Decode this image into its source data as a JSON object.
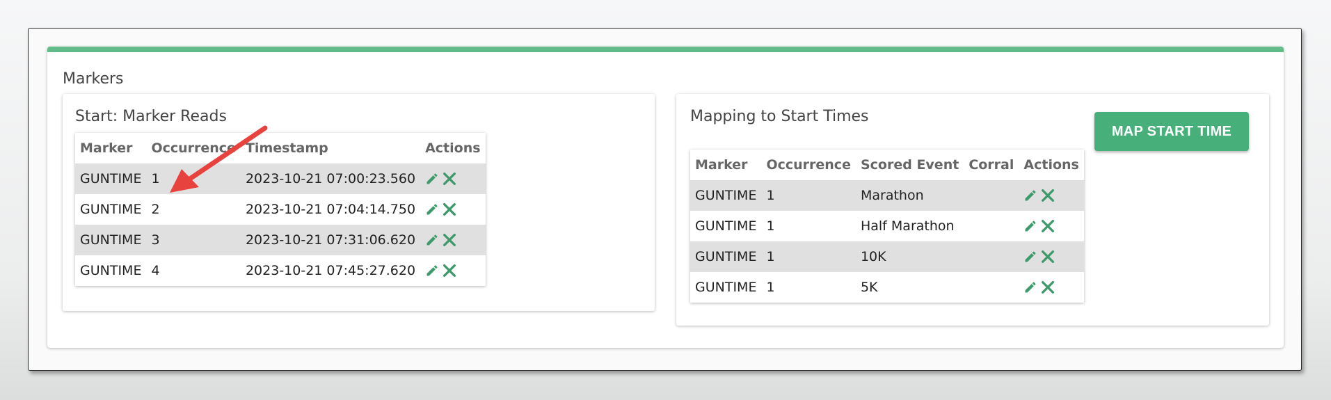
{
  "section": {
    "title": "Markers"
  },
  "reads": {
    "title": "Start: Marker Reads",
    "headers": {
      "marker": "Marker",
      "occurrence": "Occurrence",
      "timestamp": "Timestamp",
      "actions": "Actions"
    },
    "rows": [
      {
        "marker": "GUNTIME",
        "occurrence": "1",
        "timestamp": "2023-10-21 07:00:23.560"
      },
      {
        "marker": "GUNTIME",
        "occurrence": "2",
        "timestamp": "2023-10-21 07:04:14.750"
      },
      {
        "marker": "GUNTIME",
        "occurrence": "3",
        "timestamp": "2023-10-21 07:31:06.620"
      },
      {
        "marker": "GUNTIME",
        "occurrence": "4",
        "timestamp": "2023-10-21 07:45:27.620"
      }
    ]
  },
  "mapping": {
    "title": "Mapping to Start Times",
    "button_label": "MAP START TIME",
    "headers": {
      "marker": "Marker",
      "occurrence": "Occurrence",
      "event": "Scored Event",
      "corral": "Corral",
      "actions": "Actions"
    },
    "rows": [
      {
        "marker": "GUNTIME",
        "occurrence": "1",
        "event": "Marathon",
        "corral": ""
      },
      {
        "marker": "GUNTIME",
        "occurrence": "1",
        "event": "Half Marathon",
        "corral": ""
      },
      {
        "marker": "GUNTIME",
        "occurrence": "1",
        "event": "10K",
        "corral": ""
      },
      {
        "marker": "GUNTIME",
        "occurrence": "1",
        "event": "5K",
        "corral": ""
      }
    ]
  },
  "icons": {
    "edit": "pencil-icon",
    "delete": "close-icon"
  },
  "colors": {
    "accent": "#62bc8a",
    "button": "#47b07a",
    "icon": "#3e9a6a",
    "row_stripe": "#e0e0e0",
    "annotation": "#e8423f"
  }
}
